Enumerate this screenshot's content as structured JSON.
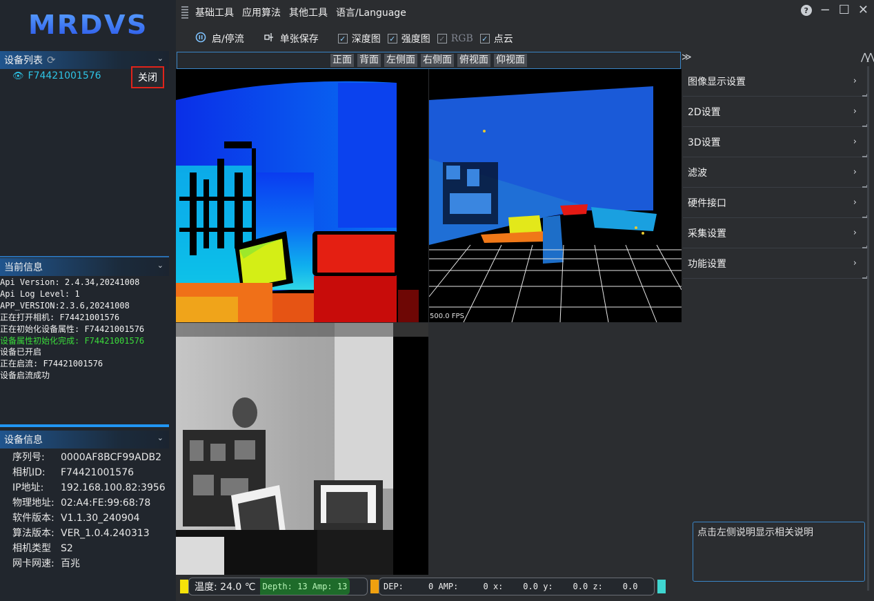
{
  "app": {
    "logo": "MRDVS"
  },
  "menubar": {
    "items": [
      "基础工具",
      "应用算法",
      "其他工具",
      "语言/Language"
    ],
    "help_icon": "question-circle-icon",
    "minimize": "−",
    "maximize": "☐",
    "close": "✕"
  },
  "toolbar": {
    "stream_label": "启/停流",
    "stream_icon": "pause-circle-icon",
    "save_label": "单张保存",
    "save_icon": "single-save-icon",
    "checkboxes": [
      {
        "label": "深度图",
        "checked": true,
        "enabled": true
      },
      {
        "label": "强度图",
        "checked": true,
        "enabled": true
      },
      {
        "label": "RGB",
        "checked": true,
        "enabled": false
      },
      {
        "label": "点云",
        "checked": true,
        "enabled": true
      }
    ]
  },
  "view_tabs": [
    "正面",
    "背面",
    "左侧面",
    "右侧面",
    "俯视面",
    "仰视面"
  ],
  "device_list": {
    "title": "设备列表",
    "device_id": "F74421001576",
    "close_label": "关闭"
  },
  "current_info": {
    "title": "当前信息",
    "lines": [
      {
        "text": "Api Version: 2.4.34,20241008",
        "ok": false
      },
      {
        "text": "Api Log Level: 1",
        "ok": false
      },
      {
        "text": "APP_VERSION:2.3.6,20241008",
        "ok": false
      },
      {
        "text": "正在打开相机: F74421001576",
        "ok": false
      },
      {
        "text": "正在初始化设备属性: F74421001576",
        "ok": false
      },
      {
        "text": "设备属性初始化完成: F74421001576",
        "ok": true
      },
      {
        "text": "设备已开启",
        "ok": false
      },
      {
        "text": "正在启流: F74421001576",
        "ok": false
      },
      {
        "text": "设备启流成功",
        "ok": false
      }
    ]
  },
  "device_info": {
    "title": "设备信息",
    "rows": [
      {
        "key": "序列号:",
        "value": "0000AF8BCF99ADB2"
      },
      {
        "key": "相机ID:",
        "value": "F74421001576"
      },
      {
        "key": "IP地址:",
        "value": "192.168.100.82:3956"
      },
      {
        "key": "物理地址:",
        "value": "02:A4:FE:99:68:78"
      },
      {
        "key": "软件版本:",
        "value": "V1.1.30_240904"
      },
      {
        "key": "算法版本:",
        "value": "VER_1.0.4.240313"
      },
      {
        "key": "相机类型",
        "value": "S2"
      },
      {
        "key": "网卡网速:",
        "value": "百兆"
      }
    ]
  },
  "viewport": {
    "fps": "500.0 FPS"
  },
  "status": {
    "temp": "温度: 24.0 ℃",
    "depth_amp": "Depth: 13 Amp: 13",
    "readout": "DEP:     0 AMP:     0 x:    0.0 y:    0.0 z:    0.0",
    "colors": {
      "yellow": "#f5e20a",
      "orange": "#f0a010",
      "cyan": "#3fd6d0"
    }
  },
  "settings_panel": {
    "items": [
      "图像显示设置",
      "2D设置",
      "3D设置",
      "滤波",
      "硬件接口",
      "采集设置",
      "功能设置"
    ],
    "help_text": "点击左侧说明显示相关说明"
  }
}
